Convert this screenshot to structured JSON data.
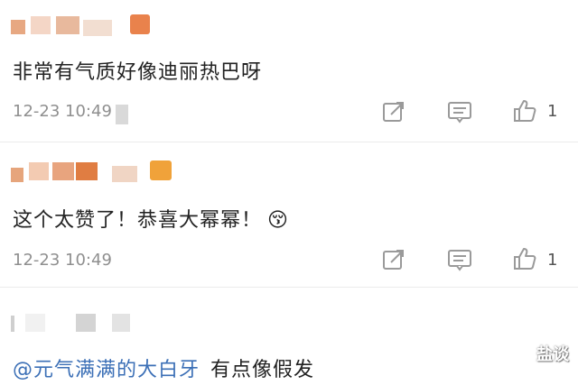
{
  "comments": [
    {
      "text": "非常有气质好像迪丽热巴呀",
      "time": "12-23 10:49",
      "like_count": "1"
    },
    {
      "text": "这个太赞了！恭喜大幂幂！",
      "emoji": "😚",
      "time": "12-23 10:49",
      "like_count": "1"
    },
    {
      "mention": "@元气满满的大白牙",
      "text": "有点像假发"
    }
  ],
  "watermark": "盐谈",
  "icons": {
    "share": "share-icon",
    "reply": "comment-icon",
    "like": "thumbs-up-icon"
  },
  "colors": {
    "mention": "#3b6fb6",
    "timestamp": "#8f8f8f",
    "icon": "#9a9a9a"
  }
}
